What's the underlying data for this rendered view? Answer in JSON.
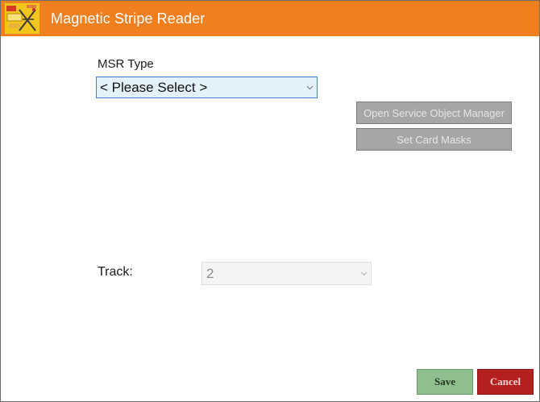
{
  "window": {
    "title": "Magnetic Stripe Reader",
    "accent_color": "#f07f1f"
  },
  "logo": {
    "icon": "app-logo-icon"
  },
  "msr": {
    "label": "MSR Type",
    "selected": "< Please Select >"
  },
  "buttons": {
    "open_service_object_manager": "Open Service Object Manager",
    "set_card_masks": "Set Card Masks",
    "save": "Save",
    "cancel": "Cancel"
  },
  "track": {
    "label": "Track:",
    "selected": "2"
  },
  "colors": {
    "save": "#8fbf8e",
    "cancel": "#b42020",
    "disabled_button": "#a6a6a6"
  }
}
